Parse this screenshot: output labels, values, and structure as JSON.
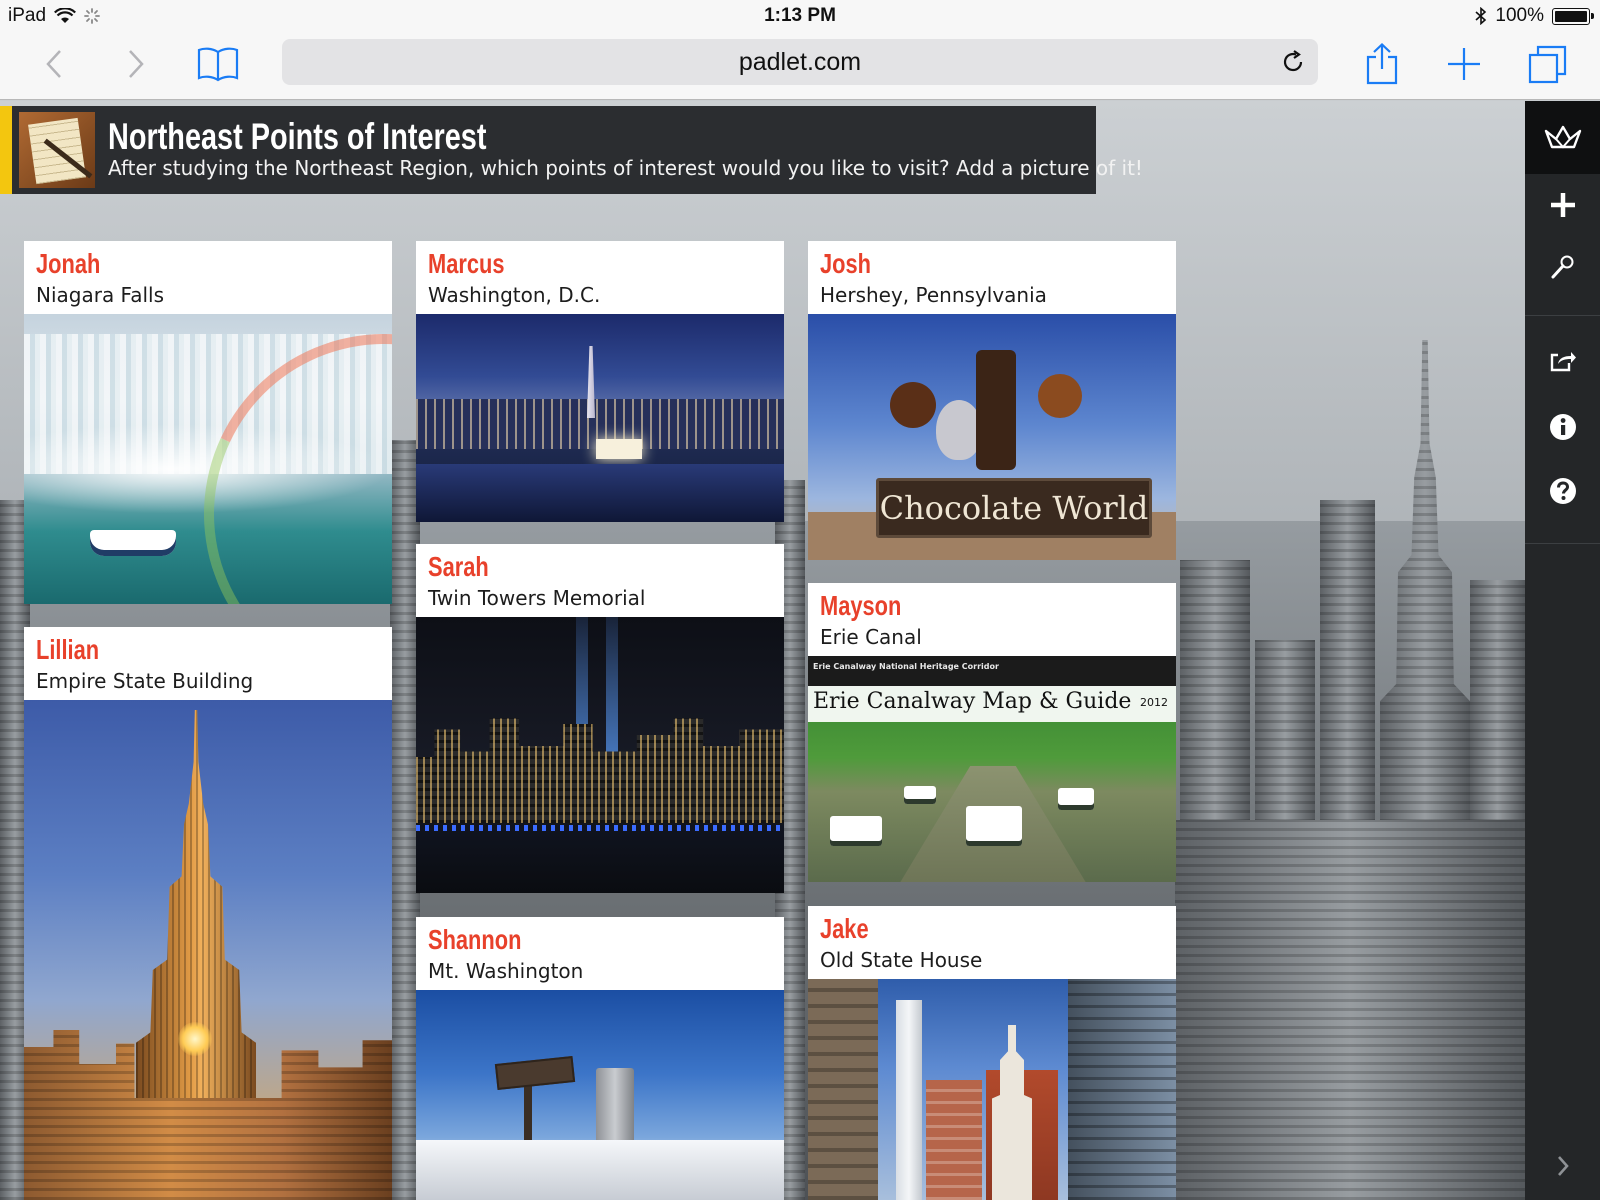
{
  "status_bar": {
    "device": "iPad",
    "time": "1:13 PM",
    "battery": "100%",
    "battery_level": 1.0
  },
  "browser": {
    "url": "padlet.com",
    "icons": [
      "back-icon",
      "forward-icon",
      "bookmarks-icon",
      "reload-icon",
      "share-icon",
      "new-tab-icon",
      "tabs-icon"
    ]
  },
  "wall": {
    "title": "Northeast Points of Interest",
    "description": "After studying the Northeast Region, which points of interest would you like to visit? Add a picture of it!",
    "accent_color": "#f3c60f",
    "author_color": "#e8412b"
  },
  "sidebar": {
    "icons": [
      "padlet-logo-icon",
      "add-icon",
      "wrench-icon",
      "share-icon",
      "info-icon",
      "help-icon",
      "chevron-right-icon"
    ]
  },
  "posts": [
    {
      "author": "Jonah",
      "place": "Niagara Falls"
    },
    {
      "author": "Marcus",
      "place": "Washington, D.C."
    },
    {
      "author": "Josh",
      "place": "Hershey, Pennsylvania",
      "image_text": "Chocolate World"
    },
    {
      "author": "Lillian",
      "place": "Empire State Building"
    },
    {
      "author": "Sarah",
      "place": "Twin Towers Memorial"
    },
    {
      "author": "Mayson",
      "place": "Erie Canal",
      "image_header": "Erie Canalway National Heritage Corridor",
      "image_title": "Erie Canalway Map & Guide",
      "image_year": "2012"
    },
    {
      "author": "Shannon",
      "place": "Mt. Washington"
    },
    {
      "author": "Jake",
      "place": "Old State House"
    }
  ]
}
